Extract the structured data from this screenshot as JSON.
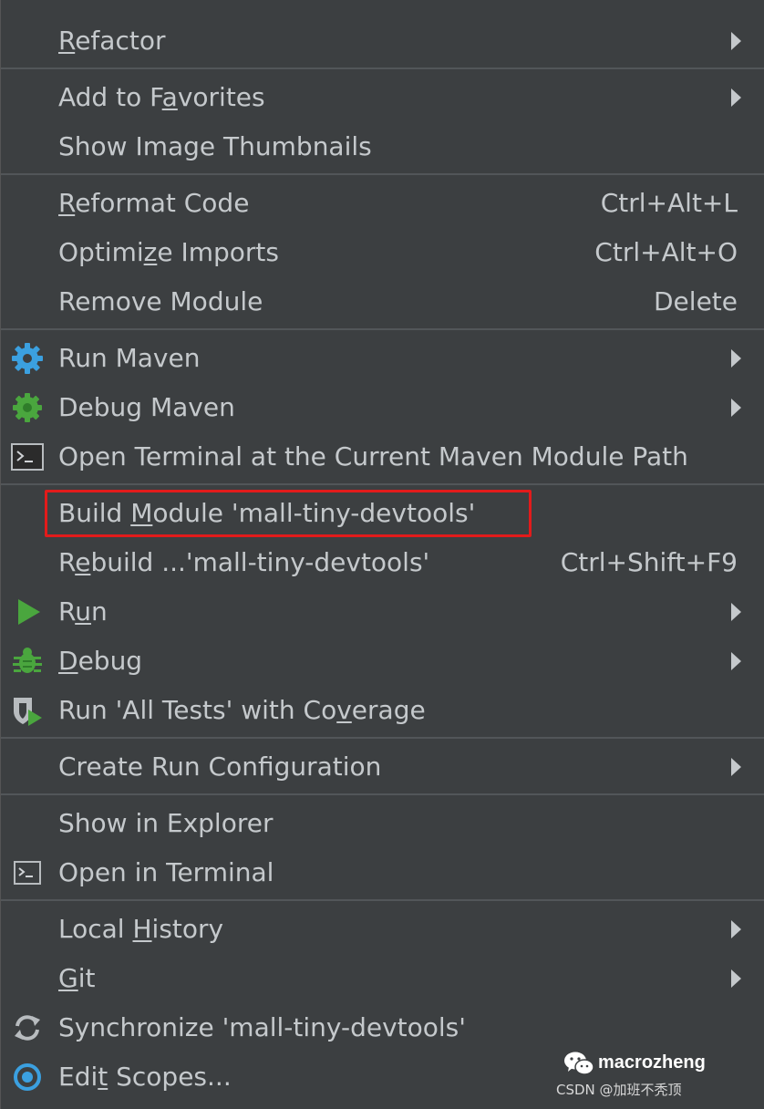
{
  "menu": {
    "items": [
      {
        "label_pre": "",
        "mnemonic": "R",
        "label_post": "efactor",
        "shortcut": "",
        "submenu": true,
        "icon": ""
      },
      {
        "label_pre": "Add to F",
        "mnemonic": "a",
        "label_post": "vorites",
        "shortcut": "",
        "submenu": true,
        "icon": ""
      },
      {
        "label_pre": "Show Image Thumbnails",
        "mnemonic": "",
        "label_post": "",
        "shortcut": "",
        "submenu": false,
        "icon": ""
      },
      {
        "label_pre": "",
        "mnemonic": "R",
        "label_post": "eformat Code",
        "shortcut": "Ctrl+Alt+L",
        "submenu": false,
        "icon": ""
      },
      {
        "label_pre": "Optimi",
        "mnemonic": "z",
        "label_post": "e Imports",
        "shortcut": "Ctrl+Alt+O",
        "submenu": false,
        "icon": ""
      },
      {
        "label_pre": "Remove Module",
        "mnemonic": "",
        "label_post": "",
        "shortcut": "Delete",
        "submenu": false,
        "icon": ""
      },
      {
        "label_pre": "Run Maven",
        "mnemonic": "",
        "label_post": "",
        "shortcut": "",
        "submenu": true,
        "icon": "gear-icon"
      },
      {
        "label_pre": "Debug Maven",
        "mnemonic": "",
        "label_post": "",
        "shortcut": "",
        "submenu": true,
        "icon": "debug-maven-icon"
      },
      {
        "label_pre": "Open Terminal at the Current Maven Module Path",
        "mnemonic": "",
        "label_post": "",
        "shortcut": "",
        "submenu": false,
        "icon": "terminal-icon"
      },
      {
        "label_pre": "Build ",
        "mnemonic": "M",
        "label_post": "odule 'mall-tiny-devtools'",
        "shortcut": "",
        "submenu": false,
        "icon": ""
      },
      {
        "label_pre": "R",
        "mnemonic": "e",
        "label_post": "build ...'mall-tiny-devtools'",
        "shortcut": "Ctrl+Shift+F9",
        "submenu": false,
        "icon": ""
      },
      {
        "label_pre": "R",
        "mnemonic": "u",
        "label_post": "n",
        "shortcut": "",
        "submenu": true,
        "icon": "run-icon"
      },
      {
        "label_pre": "",
        "mnemonic": "D",
        "label_post": "ebug",
        "shortcut": "",
        "submenu": true,
        "icon": "bug-icon"
      },
      {
        "label_pre": "Run 'All Tests' with Co",
        "mnemonic": "v",
        "label_post": "erage",
        "shortcut": "",
        "submenu": false,
        "icon": "coverage-icon"
      },
      {
        "label_pre": "Create Run Configuration",
        "mnemonic": "",
        "label_post": "",
        "shortcut": "",
        "submenu": true,
        "icon": ""
      },
      {
        "label_pre": "Show in Explorer",
        "mnemonic": "",
        "label_post": "",
        "shortcut": "",
        "submenu": false,
        "icon": ""
      },
      {
        "label_pre": "Open in Terminal",
        "mnemonic": "",
        "label_post": "",
        "shortcut": "",
        "submenu": false,
        "icon": "terminal-icon"
      },
      {
        "label_pre": "Local ",
        "mnemonic": "H",
        "label_post": "istory",
        "shortcut": "",
        "submenu": true,
        "icon": ""
      },
      {
        "label_pre": "",
        "mnemonic": "G",
        "label_post": "it",
        "shortcut": "",
        "submenu": true,
        "icon": ""
      },
      {
        "label_pre": "Synchronize 'mall-tiny-devtools'",
        "mnemonic": "",
        "label_post": "",
        "shortcut": "",
        "submenu": false,
        "icon": "sync-icon"
      },
      {
        "label_pre": "Edi",
        "mnemonic": "t",
        "label_post": " Scopes...",
        "shortcut": "",
        "submenu": false,
        "icon": "scope-icon"
      }
    ]
  },
  "watermark": {
    "name": "macrozheng",
    "sub": "CSDN @加班不秃顶"
  },
  "colors": {
    "background": "#3c3f41",
    "text": "#c5c9cc",
    "separator": "#525659",
    "highlight": "#e21b1b"
  }
}
